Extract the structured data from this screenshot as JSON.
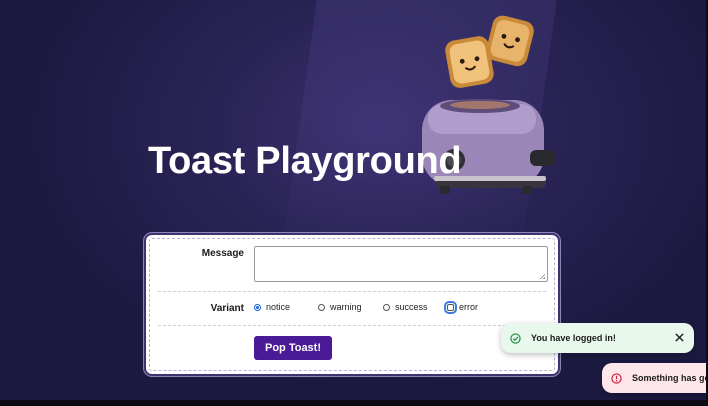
{
  "page": {
    "title": "Toast Playground"
  },
  "form": {
    "message_label": "Message",
    "message_value": "",
    "variant_label": "Variant",
    "variants": [
      {
        "label": "notice",
        "selected": true
      },
      {
        "label": "warning",
        "selected": false
      },
      {
        "label": "success",
        "selected": false
      },
      {
        "label": "error",
        "selected": false,
        "focused": true
      }
    ],
    "submit_label": "Pop Toast!"
  },
  "toasts": [
    {
      "variant": "success",
      "message": "You have logged in!",
      "icon": "check-circle-icon",
      "color": "#1f8a3b"
    },
    {
      "variant": "error",
      "message": "Something has go",
      "icon": "alert-circle-icon",
      "color": "#d21f3c"
    }
  ],
  "colors": {
    "background": "#1c1940",
    "accent": "#4b1a96",
    "success_bg": "#e8f8ec",
    "error_bg": "#fde7ea"
  }
}
